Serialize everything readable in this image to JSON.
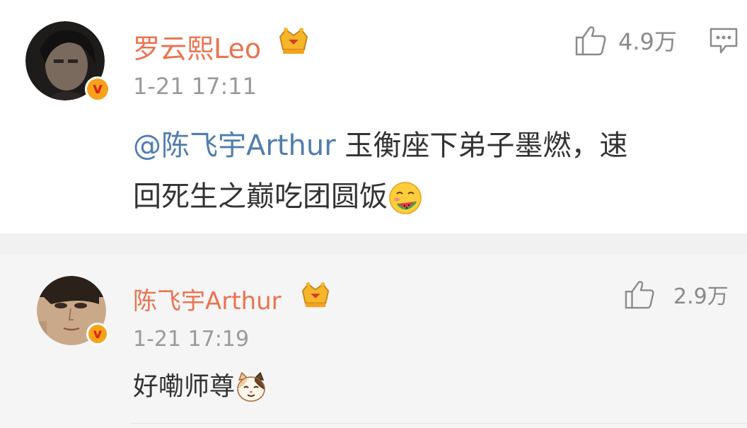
{
  "main_comment": {
    "username": "罗云熙Leo",
    "timestamp": "1-21 17:11",
    "like_count": "4.9万",
    "mention": "@陈飞宇Arthur",
    "text_line1_rest": " 玉衡座下弟子墨燃，速",
    "text_line2": "回死生之巅吃团圆饭",
    "emoji": "watermelon-eating-emoji"
  },
  "reply_comment": {
    "username": "陈飞宇Arthur",
    "timestamp": "1-21 17:19",
    "like_count": "2.9万",
    "text": "好嘞师尊",
    "emoji": "cat-emoji"
  },
  "icons": {
    "like": "thumbs-up-icon",
    "reply": "comment-icon",
    "badge": "verified-v-icon",
    "crown": "crown-vip-icon"
  },
  "colors": {
    "username": "#eb7350",
    "mention": "#507daf",
    "badge": "#f7a21b",
    "muted": "#9a9a9a"
  }
}
